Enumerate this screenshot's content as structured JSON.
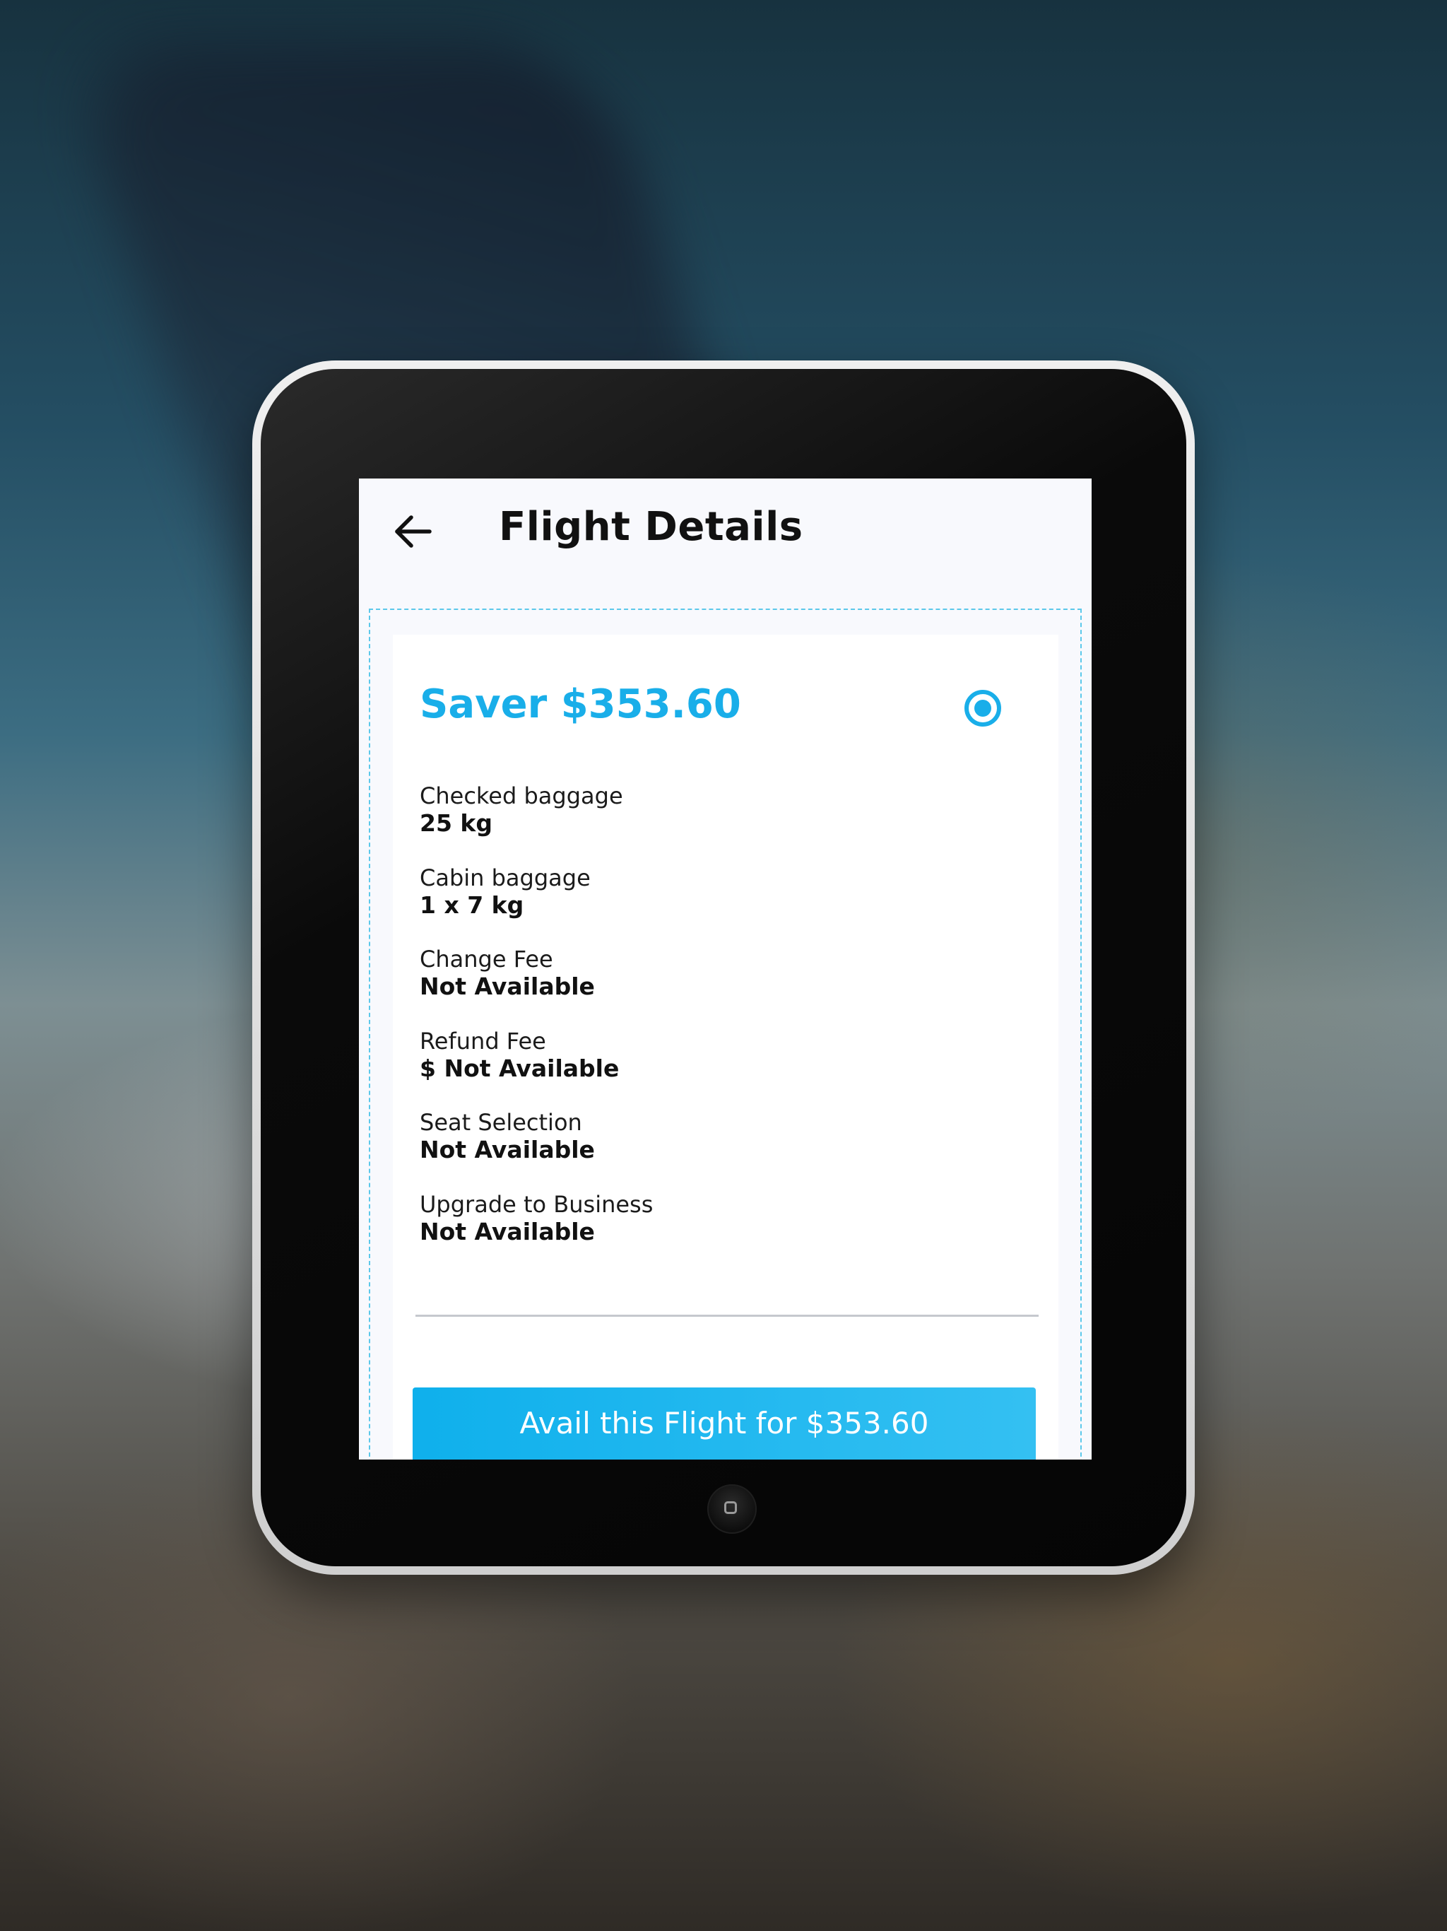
{
  "header": {
    "title": "Flight Details",
    "back_icon": "arrow-left-icon"
  },
  "fare": {
    "title": "Saver $353.60",
    "selected": true,
    "accent_color": "#19aee9",
    "features": [
      {
        "label": "Checked baggage",
        "value": "25 kg"
      },
      {
        "label": "Cabin baggage",
        "value": "1 x 7 kg"
      },
      {
        "label": "Change Fee",
        "value": "Not Available"
      },
      {
        "label": "Refund Fee",
        "value": "$ Not Available"
      },
      {
        "label": "Seat Selection",
        "value": "Not Available"
      },
      {
        "label": "Upgrade to Business",
        "value": "Not Available"
      }
    ]
  },
  "cta": {
    "label": "Avail this Flight for $353.60"
  }
}
